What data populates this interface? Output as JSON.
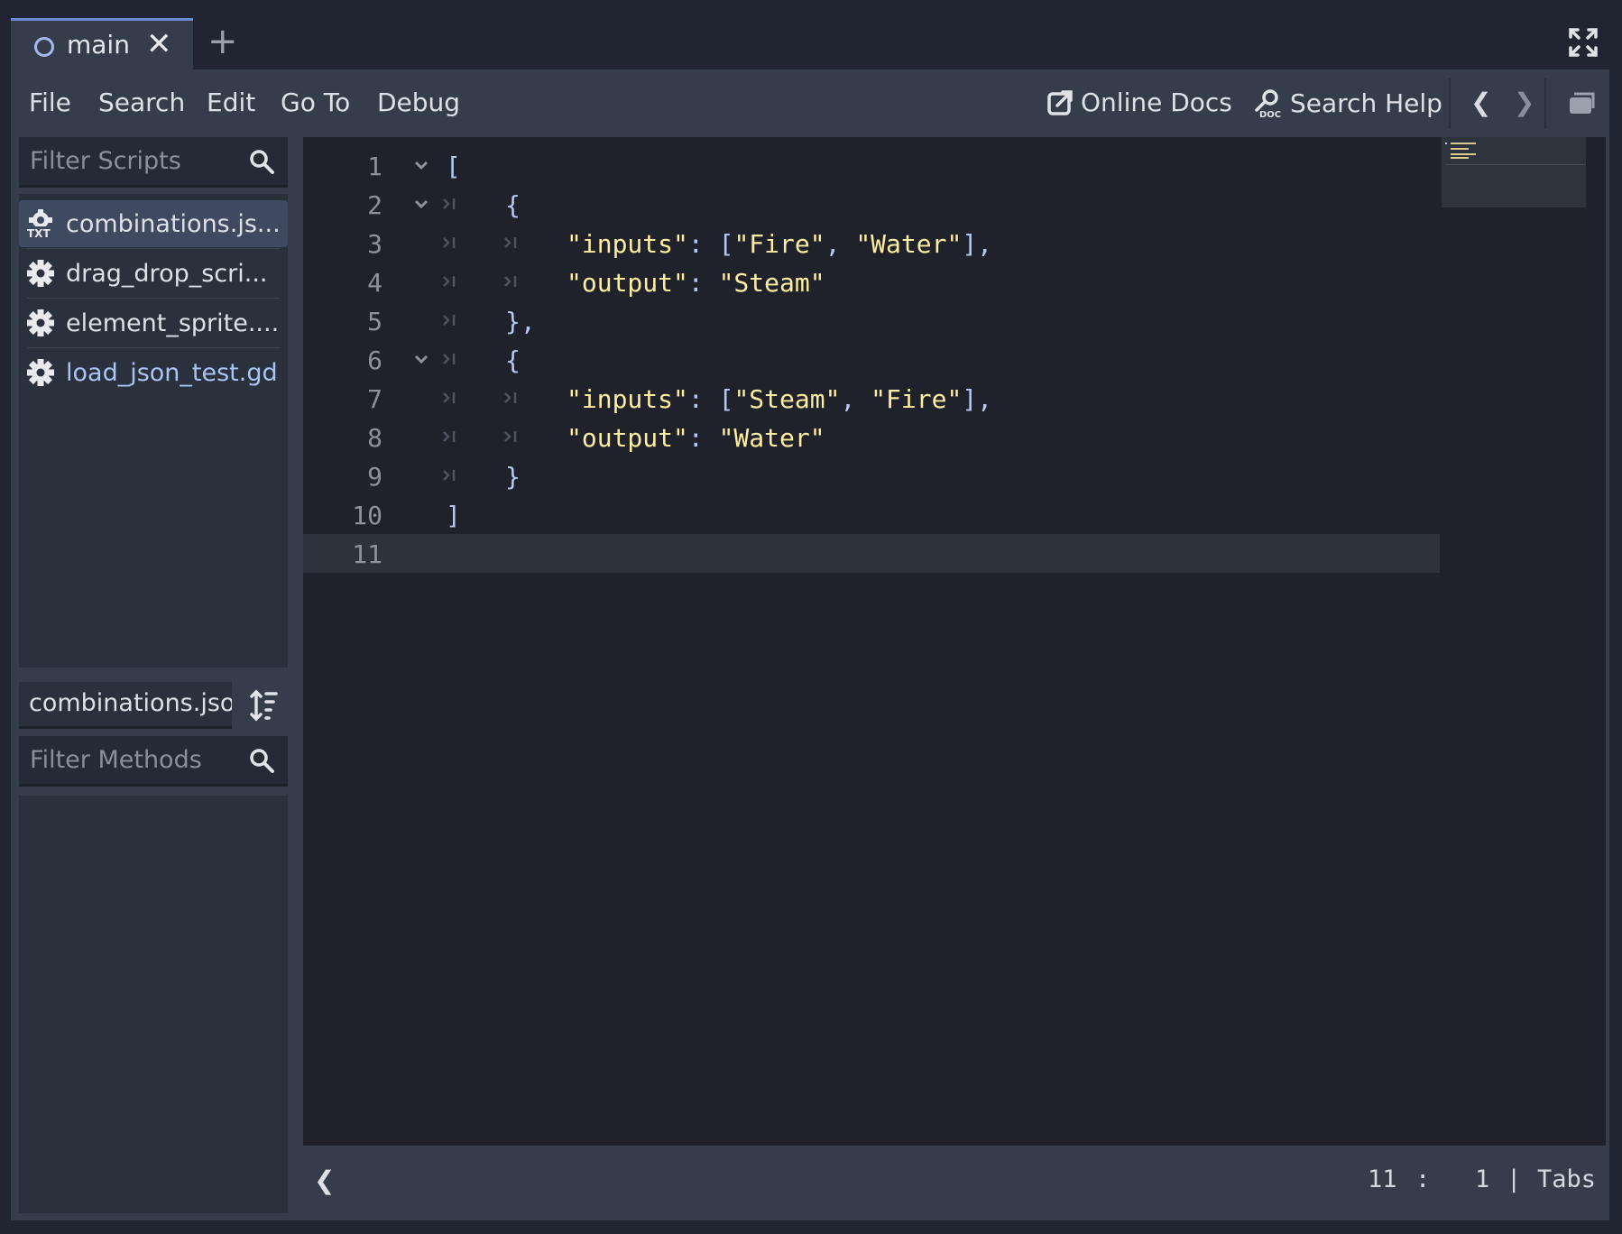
{
  "tab": {
    "label": "main",
    "close_glyph": "✕",
    "add_glyph": "+"
  },
  "menu": {
    "file": "File",
    "search": "Search",
    "edit": "Edit",
    "goto": "Go To",
    "debug": "Debug"
  },
  "help": {
    "online_docs": "Online Docs",
    "search_help": "Search Help"
  },
  "nav": {
    "back": "❮",
    "forward": "❯"
  },
  "scripts": {
    "filter_placeholder": "Filter Scripts",
    "items": [
      {
        "label": "combinations.js...",
        "icon": "txt-file-icon",
        "selected": true
      },
      {
        "label": "drag_drop_scri...",
        "icon": "gear-icon"
      },
      {
        "label": "element_sprite....",
        "icon": "gear-icon"
      },
      {
        "label": "load_json_test.gd",
        "icon": "gear-icon"
      }
    ]
  },
  "methods": {
    "current_file": "combinations.jso",
    "filter_placeholder": "Filter Methods"
  },
  "editor": {
    "lines": [
      {
        "num": "1"
      },
      {
        "num": "2"
      },
      {
        "num": "3"
      },
      {
        "num": "4"
      },
      {
        "num": "5"
      },
      {
        "num": "6"
      },
      {
        "num": "7"
      },
      {
        "num": "8"
      },
      {
        "num": "9"
      },
      {
        "num": "10"
      },
      {
        "num": "11"
      }
    ],
    "code": {
      "l1": "[",
      "l2": "{",
      "l3_key": "\"inputs\"",
      "l3_colon": ": [",
      "l3_a": "\"Fire\"",
      "l3_comma": ", ",
      "l3_b": "\"Water\"",
      "l3_end": "],",
      "l4_key": "\"output\"",
      "l4_colon": ": ",
      "l4_val": "\"Steam\"",
      "l5": "},",
      "l6": "{",
      "l7_key": "\"inputs\"",
      "l7_colon": ": [",
      "l7_a": "\"Steam\"",
      "l7_comma": ", ",
      "l7_b": "\"Fire\"",
      "l7_end": "],",
      "l8_key": "\"output\"",
      "l8_colon": ": ",
      "l8_val": "\"Water\"",
      "l9": "}",
      "l10": "]"
    }
  },
  "status": {
    "collapse": "❮",
    "line": "11",
    "colon": ":",
    "col": "1",
    "pipe": "|",
    "indent": "Tabs"
  },
  "colors": {
    "accent": "#6c8bd6",
    "string": "#ffeda1",
    "punct": "#b6c8f0",
    "selected_item": "#3f4a60"
  }
}
